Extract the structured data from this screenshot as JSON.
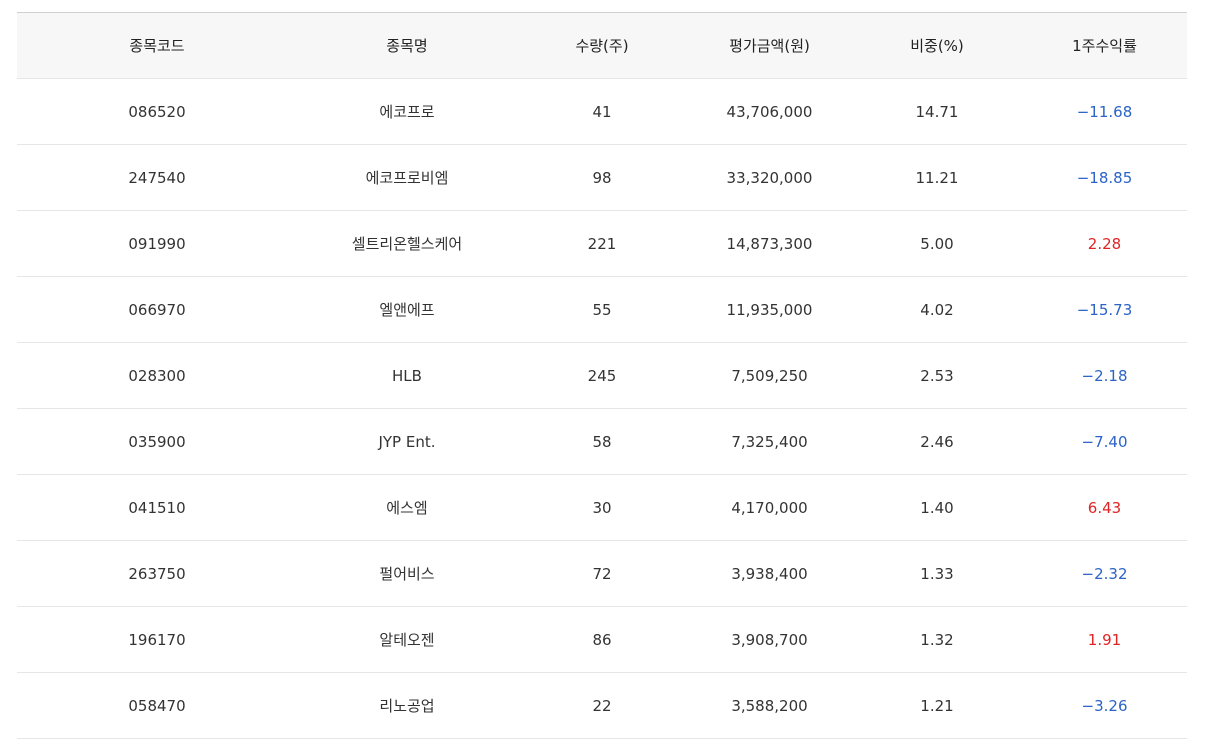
{
  "table": {
    "headers": [
      "종목코드",
      "종목명",
      "수량(주)",
      "평가금액(원)",
      "비중(%)",
      "1주수익률"
    ],
    "rows": [
      {
        "code": "086520",
        "name": "에코프로",
        "qty": "41",
        "value": "43,706,000",
        "weight": "14.71",
        "ret": "−11.68",
        "sign": "neg"
      },
      {
        "code": "247540",
        "name": "에코프로비엠",
        "qty": "98",
        "value": "33,320,000",
        "weight": "11.21",
        "ret": "−18.85",
        "sign": "neg"
      },
      {
        "code": "091990",
        "name": "셀트리온헬스케어",
        "qty": "221",
        "value": "14,873,300",
        "weight": "5.00",
        "ret": "2.28",
        "sign": "pos"
      },
      {
        "code": "066970",
        "name": "엘앤에프",
        "qty": "55",
        "value": "11,935,000",
        "weight": "4.02",
        "ret": "−15.73",
        "sign": "neg"
      },
      {
        "code": "028300",
        "name": "HLB",
        "qty": "245",
        "value": "7,509,250",
        "weight": "2.53",
        "ret": "−2.18",
        "sign": "neg"
      },
      {
        "code": "035900",
        "name": "JYP Ent.",
        "qty": "58",
        "value": "7,325,400",
        "weight": "2.46",
        "ret": "−7.40",
        "sign": "neg"
      },
      {
        "code": "041510",
        "name": "에스엠",
        "qty": "30",
        "value": "4,170,000",
        "weight": "1.40",
        "ret": "6.43",
        "sign": "pos"
      },
      {
        "code": "263750",
        "name": "펄어비스",
        "qty": "72",
        "value": "3,938,400",
        "weight": "1.33",
        "ret": "−2.32",
        "sign": "neg"
      },
      {
        "code": "196170",
        "name": "알테오젠",
        "qty": "86",
        "value": "3,908,700",
        "weight": "1.32",
        "ret": "1.91",
        "sign": "pos"
      },
      {
        "code": "058470",
        "name": "리노공업",
        "qty": "22",
        "value": "3,588,200",
        "weight": "1.21",
        "ret": "−3.26",
        "sign": "neg"
      }
    ]
  },
  "colors": {
    "negative": "#2b63c6",
    "positive": "#e02424",
    "header_bg": "#f7f7f7",
    "row_border": "#e6e6e6"
  }
}
